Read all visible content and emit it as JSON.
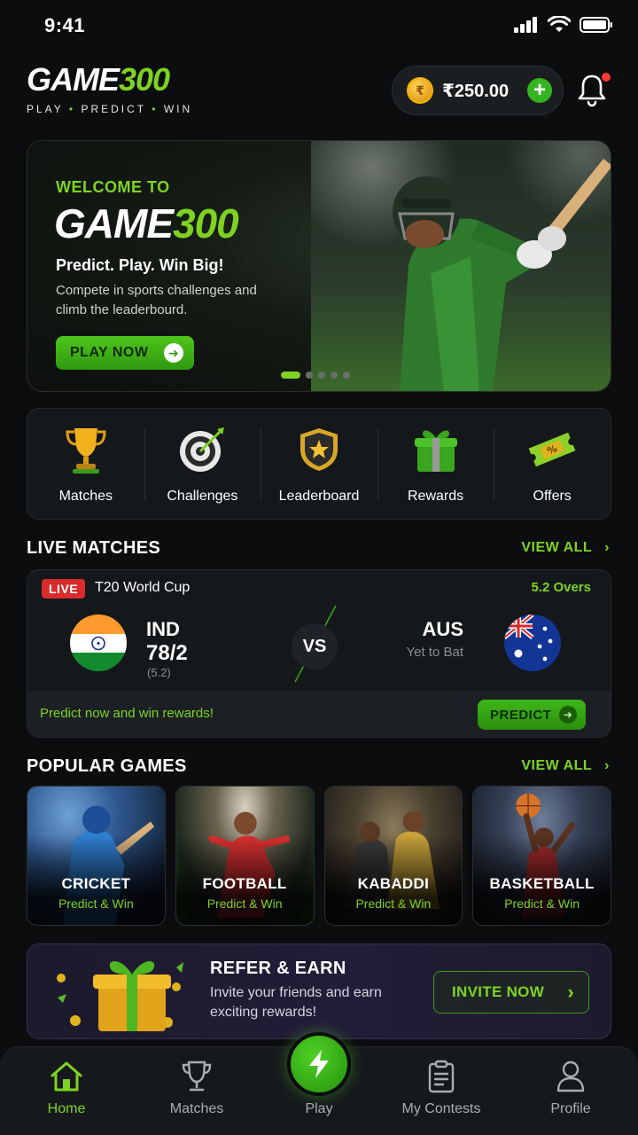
{
  "status_bar": {
    "time": "9:41"
  },
  "header": {
    "logo_white": "GAME",
    "logo_green": "300",
    "tagline_parts": [
      "PLAY",
      "PREDICT",
      "WIN"
    ],
    "wallet_amount": "₹250.00",
    "wallet_add_label": "+"
  },
  "hero": {
    "welcome": "WELCOME TO",
    "title_white": "GAME",
    "title_green": "300",
    "tagline": "Predict. Play. Win Big!",
    "description": "Compete in sports challenges and climb the leaderbourd.",
    "cta": "PLAY NOW",
    "slides": 5,
    "active_slide": 1
  },
  "quick_menu": [
    {
      "label": "Matches",
      "icon": "trophy-icon"
    },
    {
      "label": "Challenges",
      "icon": "target-icon"
    },
    {
      "label": "Leaderboard",
      "icon": "shield-star-icon"
    },
    {
      "label": "Rewards",
      "icon": "gift-icon"
    },
    {
      "label": "Offers",
      "icon": "ticket-icon"
    }
  ],
  "live_matches": {
    "title": "LIVE MATCHES",
    "view_all": "VIEW ALL",
    "match": {
      "live_label": "LIVE",
      "tournament": "T20 World Cup",
      "overs": "5.2 Overs",
      "team_a": {
        "name": "IND",
        "score": "78/2",
        "overs": "(5.2)"
      },
      "vs": "VS",
      "team_b": {
        "name": "AUS",
        "status": "Yet to Bat"
      },
      "cta_text": "Predict now and win rewards!",
      "predict_label": "PREDICT"
    }
  },
  "popular_games": {
    "title": "POPULAR GAMES",
    "view_all": "VIEW ALL",
    "items": [
      {
        "name": "CRICKET",
        "sub": "Predict & Win"
      },
      {
        "name": "FOOTBALL",
        "sub": "Predict & Win"
      },
      {
        "name": "KABADDI",
        "sub": "Predict & Win"
      },
      {
        "name": "BASKETBALL",
        "sub": "Predict & Win"
      }
    ]
  },
  "refer": {
    "title": "REFER & EARN",
    "description": "Invite your friends and earn exciting rewards!",
    "cta": "INVITE NOW"
  },
  "bottom_nav": [
    {
      "label": "Home",
      "active": true
    },
    {
      "label": "Matches",
      "active": false
    },
    {
      "label": "Play",
      "active": false
    },
    {
      "label": "My Contests",
      "active": false
    },
    {
      "label": "Profile",
      "active": false
    }
  ],
  "colors": {
    "accent": "#7ed321",
    "background": "#0b0d0f",
    "card": "#15181b",
    "live_red": "#d92b2b"
  }
}
